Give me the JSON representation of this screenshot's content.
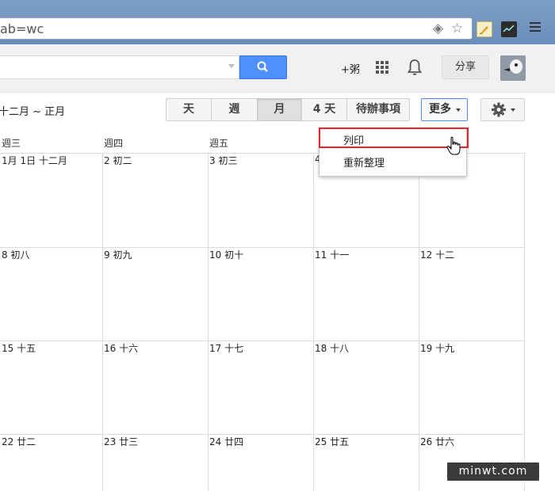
{
  "browser": {
    "url_text": "ab=wc",
    "icons": [
      "extension-diamond-icon",
      "bookmark-star-icon",
      "notes-extension-icon",
      "monitor-extension-icon",
      "menu-icon"
    ]
  },
  "google_bar": {
    "search_button_icon": "search-icon",
    "plus_name": "+粥",
    "apps_icon": "apps-grid-icon",
    "notifications_icon": "bell-icon",
    "share_label": "分享",
    "accent_color": "#4d90fe"
  },
  "toolbar": {
    "date_range": "十二月 ~ 正月",
    "views": [
      "天",
      "週",
      "月",
      "4 天",
      "待辦事項"
    ],
    "active_view": "月",
    "more_label": "更多",
    "settings_icon": "gear-icon"
  },
  "calendar": {
    "day_headers": [
      "週三",
      "週四",
      "週五",
      "",
      ""
    ],
    "rows": [
      [
        "1月 1日 十二月",
        "2 初二",
        "3 初三",
        "4",
        ""
      ],
      [
        "8 初八",
        "9 初九",
        "10 初十",
        "11 十一",
        "12 十二"
      ],
      [
        "15 十五",
        "16 十六",
        "17 十七",
        "18 十八",
        "19 十九"
      ],
      [
        "22 廿二",
        "23 廿三",
        "24 廿四",
        "25 廿五",
        "26 廿六"
      ]
    ]
  },
  "more_menu": {
    "items": [
      "列印",
      "重新整理"
    ],
    "highlighted": "列印",
    "highlight_color": "#e8242c"
  },
  "watermark": "minwt.com"
}
